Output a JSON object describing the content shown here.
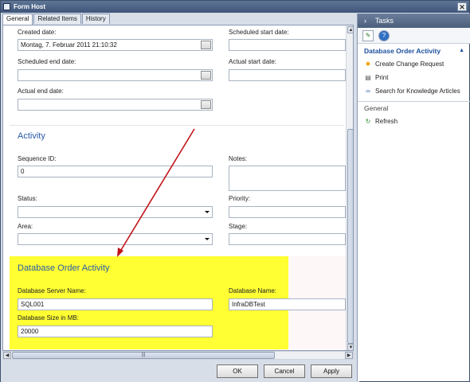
{
  "window": {
    "title": "Form Host",
    "close_glyph": "✕"
  },
  "tabs": [
    "General",
    "Related Items",
    "History"
  ],
  "form": {
    "created_date_label": "Created date:",
    "created_date_value": "Montag, 7. Februar 2011 21:10:32",
    "scheduled_start_label": "Scheduled start date:",
    "scheduled_end_label": "Scheduled end date:",
    "actual_start_label": "Actual start date:",
    "actual_end_label": "Actual end date:",
    "activity_title": "Activity",
    "sequence_id_label": "Sequence ID:",
    "sequence_id_value": "0",
    "notes_label": "Notes:",
    "status_label": "Status:",
    "priority_label": "Priority:",
    "area_label": "Area:",
    "stage_label": "Stage:",
    "db_section_title": "Database Order Activity",
    "db_server_label": "Database Server Name:",
    "db_server_value": "SQL001",
    "db_name_label": "Database Name:",
    "db_name_value": "InfraDBTest",
    "db_size_label": "Database Size in MB:",
    "db_size_value": "20000"
  },
  "buttons": {
    "ok": "OK",
    "cancel": "Cancel",
    "apply": "Apply"
  },
  "taskpane": {
    "header": "Tasks",
    "header_chevron": "›",
    "group1_title": "Database Order Activity",
    "group1_items": [
      "Create Change Request",
      "Print",
      "Search for Knowledge Articles"
    ],
    "group2_title": "General",
    "group2_items": [
      "Refresh"
    ]
  },
  "colors": {
    "highlight": "#ffff33",
    "arrow": "#c0141a",
    "section_blue": "#2a5aa8"
  }
}
